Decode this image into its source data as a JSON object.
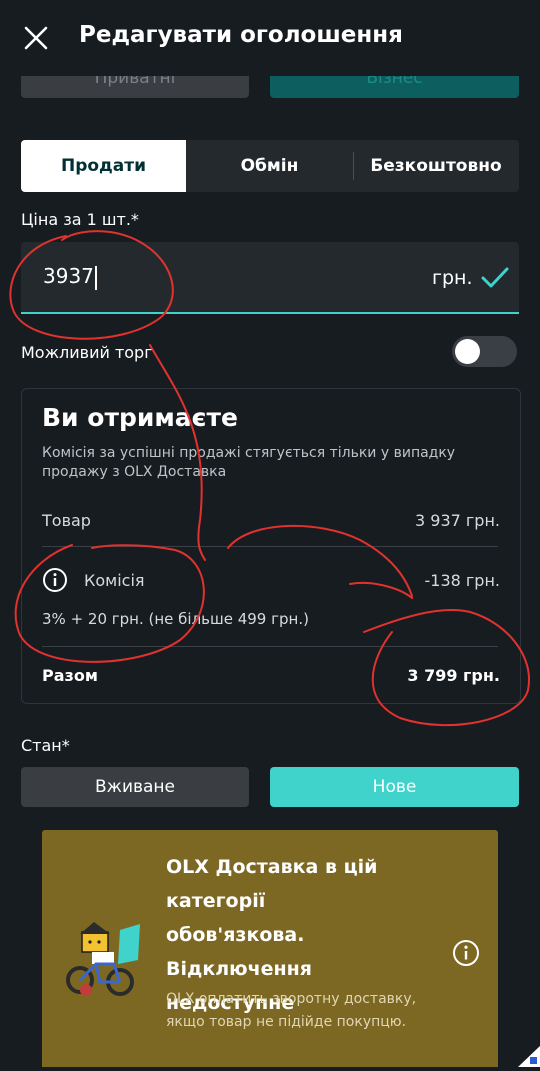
{
  "header": {
    "title": "Редагувати оголошення"
  },
  "seller_type": {
    "private_label": "Приватні",
    "business_label": "Бізнес"
  },
  "deal_tabs": {
    "sell": "Продати",
    "exchange": "Обмін",
    "free": "Безкоштовно",
    "selected": "Продати"
  },
  "price": {
    "label": "Ціна за 1 шт.*",
    "value": "3937",
    "currency": "грн."
  },
  "negotiable": {
    "label": "Можливий торг",
    "enabled": false
  },
  "receive": {
    "title": "Ви отримаєте",
    "note": "Комісія за успішні продажі стягується тільки у випадку продажу з OLX Доставка",
    "goods_label": "Товар",
    "goods_value": "3 937 грн.",
    "fee_label": "Комісія",
    "fee_value": "-138 грн.",
    "fee_detail": "3% + 20 грн. (не більше 499 грн.)",
    "total_label": "Разом",
    "total_value": "3 799 грн."
  },
  "condition": {
    "label": "Стан*",
    "used": "Вживане",
    "new": "Нове",
    "selected": "Нове"
  },
  "delivery": {
    "title": "OLX Доставка в цій категорії обов'язкова. Відключення недоступне",
    "note": "OLX оплатить зворотну доставку, якщо товар не підійде покупцю."
  },
  "colors": {
    "background": "#171c21",
    "accent": "#3fd3cc",
    "annotation": "#e0322e",
    "banner": "#7d6823"
  }
}
